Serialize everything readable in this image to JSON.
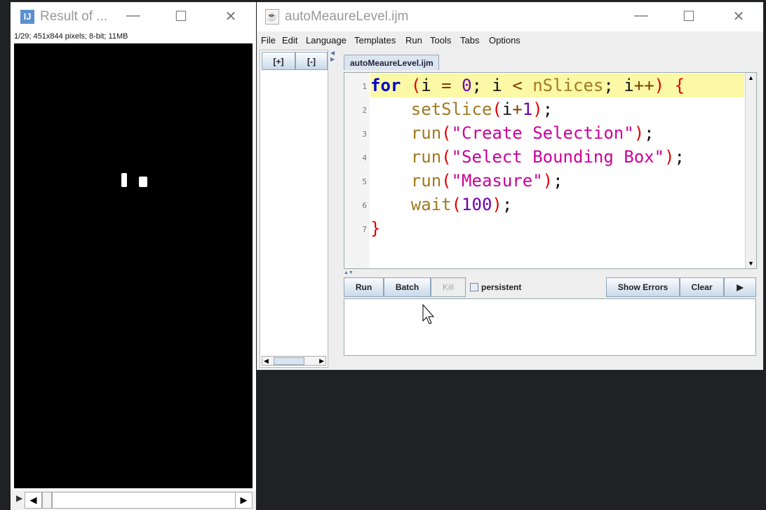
{
  "image_window": {
    "title": "Result of ...",
    "info": "1/29; 451x844 pixels; 8-bit; 11MB"
  },
  "editor_window": {
    "title": "autoMeaureLevel.ijm",
    "menu": [
      "File",
      "Edit",
      "Language",
      "Templates",
      "Run",
      "Tools",
      "Tabs",
      "Options"
    ],
    "tree_buttons": {
      "expand": "[+]",
      "collapse": "[-]"
    },
    "tab": "autoMeaureLevel.ijm",
    "code": [
      [
        [
          "for",
          "kw"
        ],
        [
          " ",
          "id"
        ],
        [
          "(",
          "pa"
        ],
        [
          "i ",
          "id"
        ],
        [
          "=",
          "op"
        ],
        [
          " ",
          "id"
        ],
        [
          "0",
          "nu"
        ],
        [
          "; i ",
          "id"
        ],
        [
          "<",
          "op"
        ],
        [
          " ",
          "id"
        ],
        [
          "nSlices",
          "fn"
        ],
        [
          "; i",
          "id"
        ],
        [
          "++",
          "op"
        ],
        [
          "",
          "id"
        ],
        [
          ")",
          "pa"
        ],
        [
          " ",
          "id"
        ],
        [
          "{",
          "pa"
        ]
      ],
      [
        [
          "    ",
          "id"
        ],
        [
          "setSlice",
          "fn"
        ],
        [
          "(",
          "pa"
        ],
        [
          "i",
          "id"
        ],
        [
          "+",
          "op"
        ],
        [
          "1",
          "nu"
        ],
        [
          ")",
          "pa"
        ],
        [
          ";",
          "id"
        ]
      ],
      [
        [
          "    ",
          "id"
        ],
        [
          "run",
          "fn"
        ],
        [
          "(",
          "pa"
        ],
        [
          "\"Create Selection\"",
          "st"
        ],
        [
          ")",
          "pa"
        ],
        [
          ";",
          "id"
        ]
      ],
      [
        [
          "    ",
          "id"
        ],
        [
          "run",
          "fn"
        ],
        [
          "(",
          "pa"
        ],
        [
          "\"Select Bounding Box\"",
          "st"
        ],
        [
          ")",
          "pa"
        ],
        [
          ";",
          "id"
        ]
      ],
      [
        [
          "    ",
          "id"
        ],
        [
          "run",
          "fn"
        ],
        [
          "(",
          "pa"
        ],
        [
          "\"Measure\"",
          "st"
        ],
        [
          ")",
          "pa"
        ],
        [
          ";",
          "id"
        ]
      ],
      [
        [
          "    ",
          "id"
        ],
        [
          "wait",
          "fn"
        ],
        [
          "(",
          "pa"
        ],
        [
          "100",
          "nu"
        ],
        [
          ")",
          "pa"
        ],
        [
          ";",
          "id"
        ]
      ],
      [
        [
          "}",
          "pa"
        ]
      ]
    ],
    "buttons": {
      "run": "Run",
      "batch": "Batch",
      "kill": "Kill",
      "persistent": "persistent",
      "show_errors": "Show Errors",
      "clear": "Clear",
      "more": "▶"
    }
  }
}
